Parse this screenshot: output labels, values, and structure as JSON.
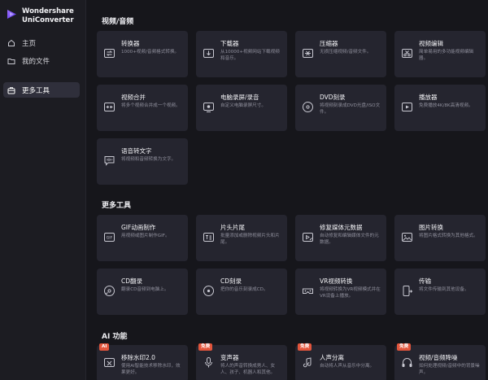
{
  "app": {
    "name_line1": "Wondershare",
    "name_line2": "UniConverter"
  },
  "sidebar": {
    "items": [
      {
        "label": "主页"
      },
      {
        "label": "我的文件"
      },
      {
        "label": "更多工具"
      }
    ]
  },
  "sections": {
    "video_audio": {
      "title": "视频/音频",
      "cards": [
        {
          "title": "转换器",
          "desc": "1000+视频/音频格式转换。"
        },
        {
          "title": "下载器",
          "desc": "从10000+视频网站下载视频和音乐。"
        },
        {
          "title": "压缩器",
          "desc": "无损压缩视频/音频文件。"
        },
        {
          "title": "视频编辑",
          "desc": "简单易用的多功能视频编辑器。"
        },
        {
          "title": "视频合并",
          "desc": "将多个视频合并成一个视频。"
        },
        {
          "title": "电脑录屏/录音",
          "desc": "自定义电脑录屏尺寸。"
        },
        {
          "title": "DVD刻录",
          "desc": "将视频刻录成DVD光盘/ISO文件。"
        },
        {
          "title": "播放器",
          "desc": "免费播放4K/8K高清视频。"
        },
        {
          "title": "语音转文字",
          "desc": "将视频和音频转换为文字。"
        }
      ]
    },
    "more_tools": {
      "title": "更多工具",
      "cards": [
        {
          "title": "GIF动画制作",
          "desc": "用视频或图片制作GIF。"
        },
        {
          "title": "片头片尾",
          "desc": "批量添加或删除视频片头和片尾。"
        },
        {
          "title": "修复媒体元数据",
          "desc": "自动修复和编辑媒体文件的元数据。"
        },
        {
          "title": "图片转换",
          "desc": "将图片格式转换为其他格式。"
        },
        {
          "title": "CD翻录",
          "desc": "翻录CD音频到电脑上。"
        },
        {
          "title": "CD刻录",
          "desc": "把你的音乐刻录成CD。"
        },
        {
          "title": "VR视频转换",
          "desc": "将视频转换为VR视频模式并在VR设备上播放。"
        },
        {
          "title": "传输",
          "desc": "将文件传输到其他设备。"
        }
      ]
    },
    "ai": {
      "title": "AI 功能",
      "cards": [
        {
          "badge": "AI",
          "title": "移除水印2.0",
          "desc": "使用AI智能技术移除水印，效果更好。"
        },
        {
          "badge": "免费",
          "title": "变声器",
          "desc": "将人的声音转换成男人、女人、孩子、机器人和其他。"
        },
        {
          "badge": "免费",
          "title": "人声分离",
          "desc": "自动将人声从音乐中分离。"
        },
        {
          "badge": "免费",
          "title": "视频/音频降噪",
          "desc": "如何处理视频/音频中的背景噪声。"
        }
      ]
    }
  },
  "colors": {
    "accent": "#7a5af8",
    "card": "#25252f",
    "badge": "#e2553c",
    "bg": "#16161b"
  }
}
